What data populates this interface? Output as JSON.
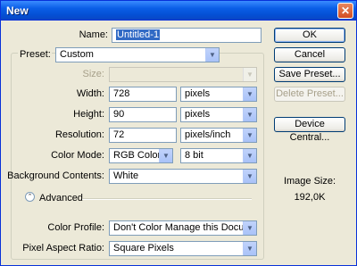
{
  "window": {
    "title": "New",
    "close_glyph": "✕"
  },
  "form": {
    "name_label": "Name:",
    "name_value": "Untitled-1",
    "preset_label": "Preset:",
    "preset_value": "Custom",
    "size_label": "Size:",
    "size_value": "",
    "width_label": "Width:",
    "width_value": "728",
    "width_unit": "pixels",
    "height_label": "Height:",
    "height_value": "90",
    "height_unit": "pixels",
    "resolution_label": "Resolution:",
    "resolution_value": "72",
    "resolution_unit": "pixels/inch",
    "color_mode_label": "Color Mode:",
    "color_mode_value": "RGB Color",
    "bit_depth_value": "8 bit",
    "background_label": "Background Contents:",
    "background_value": "White",
    "advanced_label": "Advanced",
    "color_profile_label": "Color Profile:",
    "color_profile_value": "Don't Color Manage this Document",
    "pixel_aspect_label": "Pixel Aspect Ratio:",
    "pixel_aspect_value": "Square Pixels"
  },
  "buttons": {
    "ok": "OK",
    "cancel": "Cancel",
    "save_preset": "Save Preset...",
    "delete_preset": "Delete Preset...",
    "device_central": "Device Central..."
  },
  "info": {
    "image_size_label": "Image Size:",
    "image_size_value": "192,0K"
  },
  "colors": {
    "titlebar": "#0a5ee6",
    "dialog_bg": "#ece9d8",
    "selection": "#316ac5"
  }
}
